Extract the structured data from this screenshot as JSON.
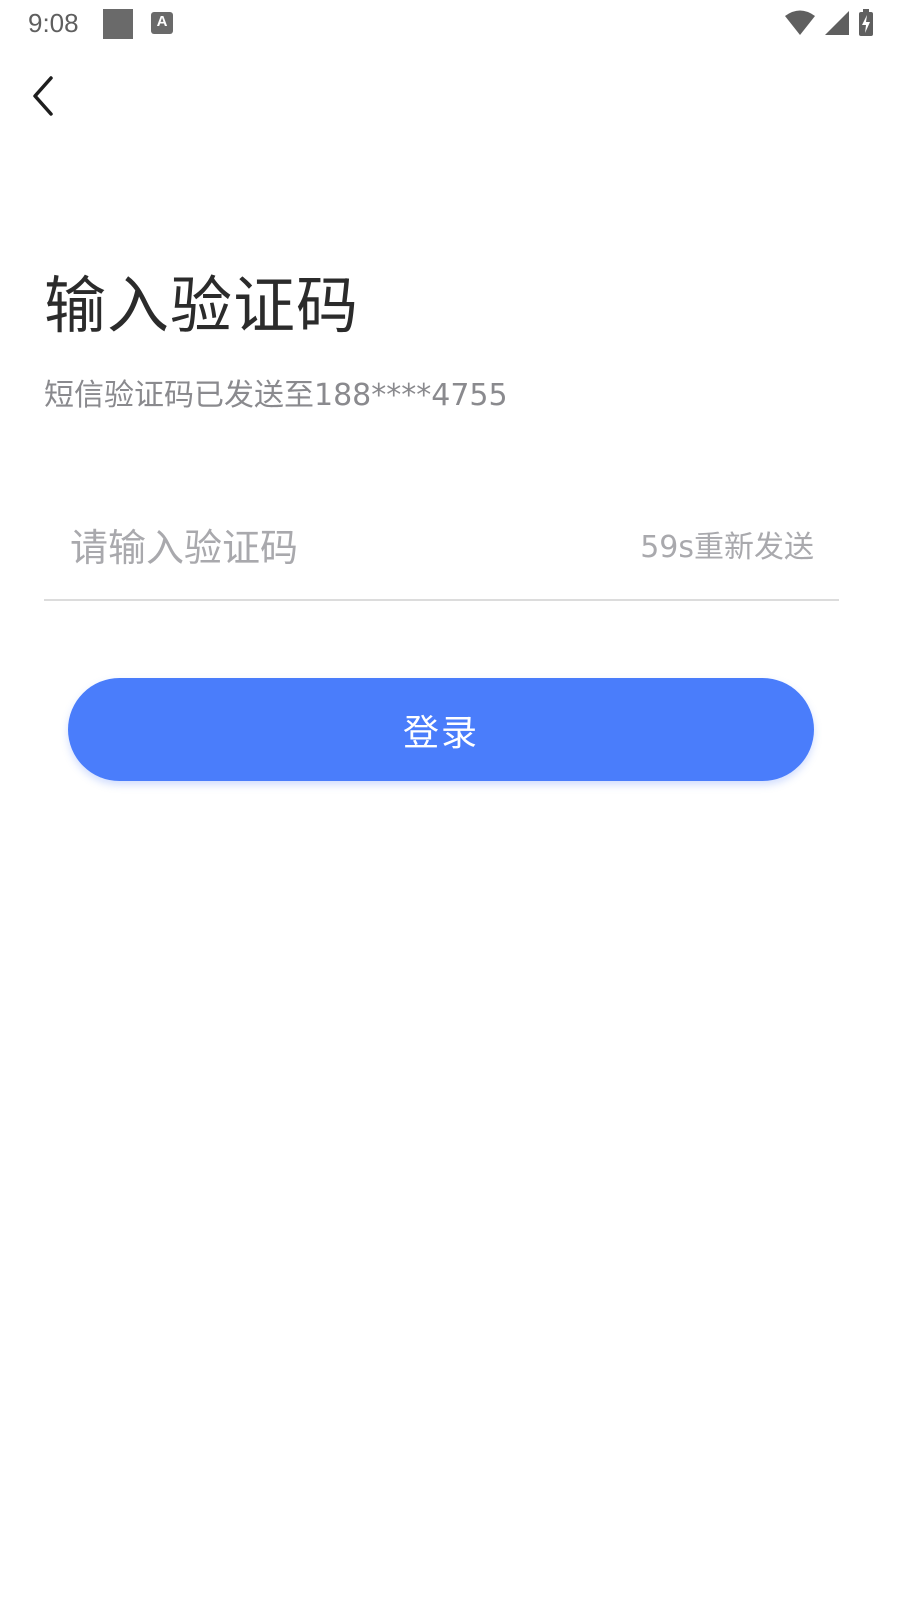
{
  "status_bar": {
    "time": "9:08",
    "notif_a_glyph": "A",
    "icons": [
      "notification-square-icon",
      "text-notification-icon",
      "wifi-icon",
      "signal-icon",
      "battery-charging-icon"
    ]
  },
  "header": {
    "back_icon": "chevron-left-icon"
  },
  "main": {
    "title": "输入验证码",
    "subtitle": "短信验证码已发送至188****4755",
    "code_input": {
      "value": "",
      "placeholder": "请输入验证码"
    },
    "resend_label": "59s重新发送",
    "login_label": "登录"
  },
  "colors": {
    "accent": "#4a7dfb",
    "title_text": "#2b2b2b",
    "secondary_text": "#8a8a8e",
    "placeholder_text": "#a9a9ad",
    "divider": "#dcdcdc"
  }
}
